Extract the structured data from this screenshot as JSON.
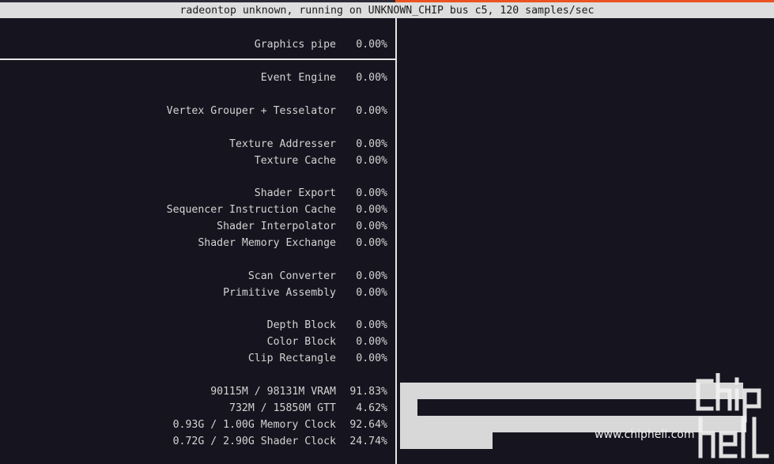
{
  "title": "radeontop unknown, running on UNKNOWN_CHIP bus c5, 120 samples/sec",
  "rows": [
    {
      "label": "Graphics pipe",
      "value": "0.00%",
      "fraction": 0.0
    },
    {
      "label": "Event Engine",
      "value": "0.00%",
      "fraction": 0.0
    },
    {
      "label": "Vertex Grouper + Tesselator",
      "value": "0.00%",
      "fraction": 0.0
    },
    {
      "label": "Texture Addresser",
      "value": "0.00%",
      "fraction": 0.0
    },
    {
      "label": "Texture Cache",
      "value": "0.00%",
      "fraction": 0.0
    },
    {
      "label": "Shader Export",
      "value": "0.00%",
      "fraction": 0.0
    },
    {
      "label": "Sequencer Instruction Cache",
      "value": "0.00%",
      "fraction": 0.0
    },
    {
      "label": "Shader Interpolator",
      "value": "0.00%",
      "fraction": 0.0
    },
    {
      "label": "Shader Memory Exchange",
      "value": "0.00%",
      "fraction": 0.0
    },
    {
      "label": "Scan Converter",
      "value": "0.00%",
      "fraction": 0.0
    },
    {
      "label": "Primitive Assembly",
      "value": "0.00%",
      "fraction": 0.0
    },
    {
      "label": "Depth Block",
      "value": "0.00%",
      "fraction": 0.0
    },
    {
      "label": "Color Block",
      "value": "0.00%",
      "fraction": 0.0
    },
    {
      "label": "Clip Rectangle",
      "value": "0.00%",
      "fraction": 0.0
    },
    {
      "label": "90115M / 98131M VRAM",
      "value": "91.83%",
      "fraction": 0.9183
    },
    {
      "label": "732M / 15850M GTT",
      "value": "4.62%",
      "fraction": 0.0462
    },
    {
      "label": "0.93G / 1.00G Memory Clock",
      "value": "92.64%",
      "fraction": 0.9264
    },
    {
      "label": "0.72G / 2.90G Shader Clock",
      "value": "24.74%",
      "fraction": 0.2474
    }
  ],
  "watermark": {
    "text": "www.chiphell.com",
    "logo": "chiphell-logo"
  },
  "colors": {
    "background": "#16151f",
    "text": "#d3d3d3",
    "title_bar": "#dedede",
    "bar_fill": "#d8d8d8",
    "accent": "#e95420"
  }
}
